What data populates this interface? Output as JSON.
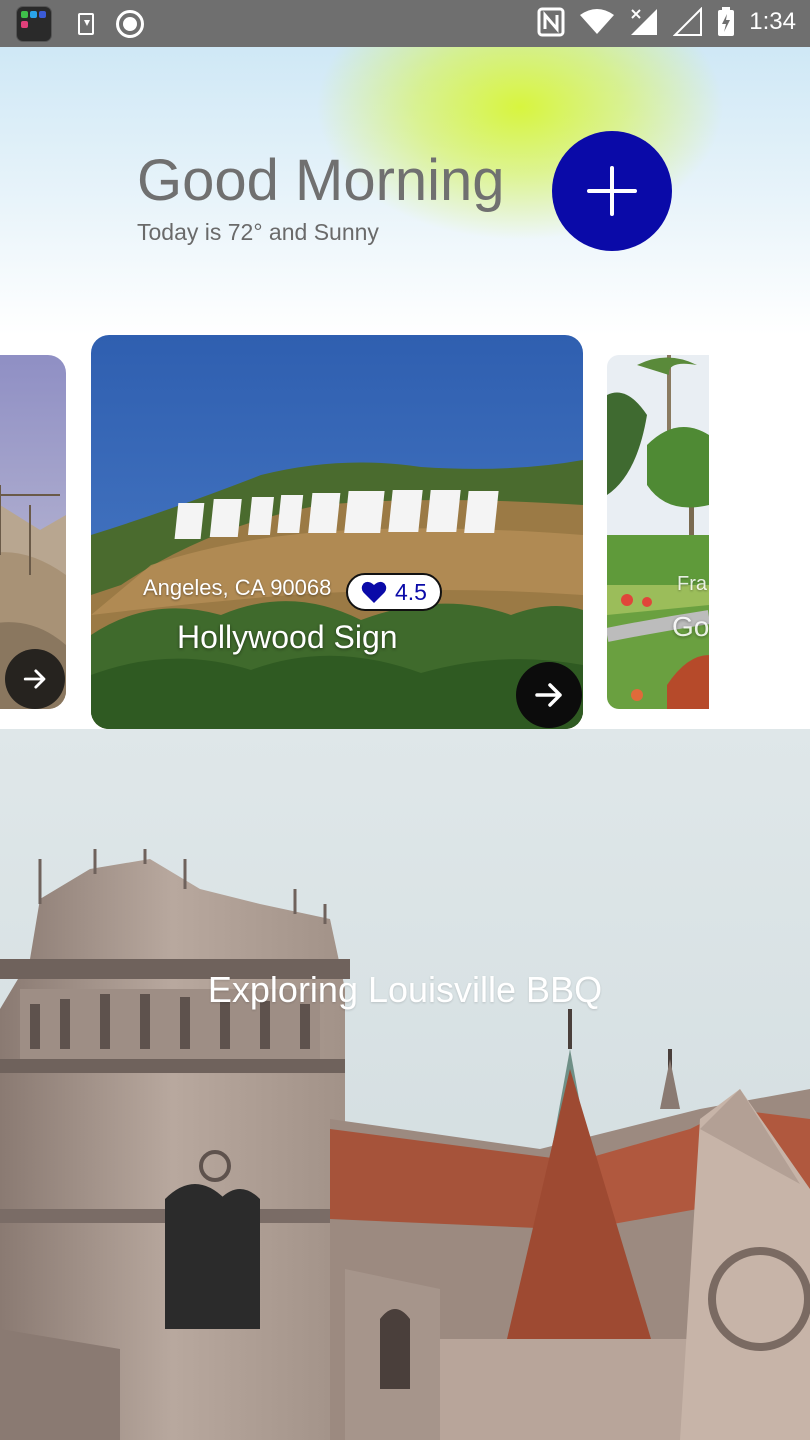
{
  "status_bar": {
    "time": "1:34",
    "left_icons": [
      "app-folder-icon",
      "download-icon",
      "screen-record-icon"
    ],
    "right_icons": [
      "nfc-icon",
      "wifi-icon",
      "signal-icon",
      "signal-empty-icon",
      "battery-charging-icon"
    ]
  },
  "header": {
    "greeting": "Good Morning",
    "weather": "Today is 72° and Sunny",
    "add_button_icon": "plus-icon",
    "accent_color": "#0a0aa8",
    "glow_color": "#d8f53f"
  },
  "carousel": {
    "cards": [
      {
        "id": "left",
        "title": "",
        "address": ""
      },
      {
        "id": "main",
        "title": "Hollywood Sign",
        "address": "Angeles, CA 90068",
        "rating": "4.5"
      },
      {
        "id": "right",
        "title": "Go",
        "address": "Fra"
      }
    ]
  },
  "feature": {
    "title": "Exploring Louisville BBQ"
  }
}
